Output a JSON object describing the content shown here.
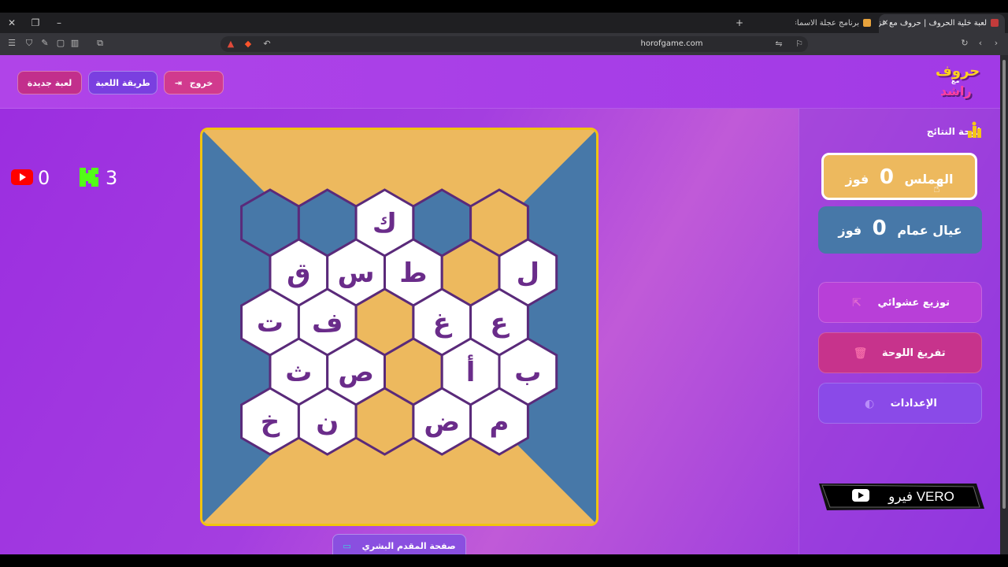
{
  "browser": {
    "tabs": [
      {
        "title": "لعبة خلية الحروف | حروف مع عزيز",
        "active": true
      },
      {
        "title": "برنامج عجلة الاسماء",
        "active": false
      }
    ],
    "new_tab_symbol": "+",
    "url": "horofgame.com"
  },
  "header": {
    "buttons": {
      "new_game": "لعبة جديدة",
      "how_to_play": "طريقة اللعبة",
      "exit": "خروج"
    },
    "logo": {
      "line1": "حروف",
      "line2": "مع",
      "line3": "راشد"
    }
  },
  "counters": {
    "youtube_count": "0",
    "kick_count": "3"
  },
  "board": {
    "colors": {
      "team1": "#edb95e",
      "team2": "#4778a8",
      "empty": "#ffffff",
      "border": "#5a2a7a",
      "letter": "#6a2c8a"
    },
    "rows": [
      [
        {
          "letter": "",
          "state": "team2"
        },
        {
          "letter": "",
          "state": "team2"
        },
        {
          "letter": "ك",
          "state": "empty"
        },
        {
          "letter": "",
          "state": "team2"
        },
        {
          "letter": "",
          "state": "team1"
        }
      ],
      [
        {
          "letter": "ق",
          "state": "empty"
        },
        {
          "letter": "س",
          "state": "empty"
        },
        {
          "letter": "ط",
          "state": "empty"
        },
        {
          "letter": "",
          "state": "team1"
        },
        {
          "letter": "ل",
          "state": "empty"
        }
      ],
      [
        {
          "letter": "ت",
          "state": "empty"
        },
        {
          "letter": "ف",
          "state": "empty"
        },
        {
          "letter": "",
          "state": "team1"
        },
        {
          "letter": "غ",
          "state": "empty"
        },
        {
          "letter": "ع",
          "state": "empty"
        }
      ],
      [
        {
          "letter": "ث",
          "state": "empty"
        },
        {
          "letter": "ص",
          "state": "empty"
        },
        {
          "letter": "",
          "state": "team1"
        },
        {
          "letter": "أ",
          "state": "empty"
        },
        {
          "letter": "ب",
          "state": "empty"
        }
      ],
      [
        {
          "letter": "خ",
          "state": "empty"
        },
        {
          "letter": "ن",
          "state": "empty"
        },
        {
          "letter": "",
          "state": "team1"
        },
        {
          "letter": "ض",
          "state": "empty"
        },
        {
          "letter": "م",
          "state": "empty"
        }
      ]
    ]
  },
  "presenter_page": "صفحة المقدم البشري",
  "scoreboard": {
    "title": "لوحة النتائج",
    "teams": [
      {
        "name": "الهملس",
        "score": "0",
        "wins_label": "فوز",
        "color": "#edb95e"
      },
      {
        "name": "عيال عمام",
        "score": "0",
        "wins_label": "فوز",
        "color": "#4778a8"
      }
    ]
  },
  "actions": {
    "shuffle": "توزيع عشوائي",
    "clear_board": "تفريغ اللوحة",
    "settings": "الإعدادات"
  },
  "watermark": {
    "text": "فيرو VERO"
  }
}
